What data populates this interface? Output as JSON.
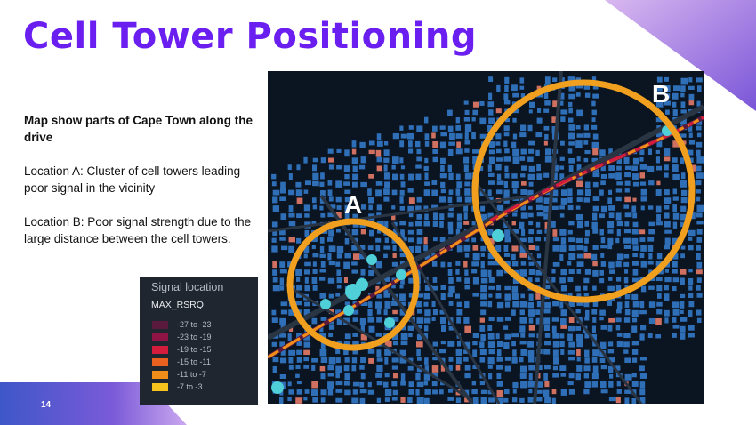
{
  "slide": {
    "title": "Cell Tower Positioning",
    "page_number": "14",
    "body": {
      "heading": "Map show parts of Cape Town along the drive",
      "location_a": "Location A: Cluster of cell towers leading poor signal in the vicinity",
      "location_b": "Location B: Poor signal strength due to the large distance between the cell towers."
    }
  },
  "map": {
    "label_a": "A",
    "label_b": "B",
    "colors": {
      "background": "#0b1522",
      "building": "#2f6fb8",
      "tower": "#4fd0d8",
      "circle": "#f0a01e",
      "road": "#2a3543"
    }
  },
  "legend": {
    "title": "Signal location",
    "field": "MAX_RSRQ",
    "items": [
      {
        "label": "-27 to -23",
        "color": "#5a1a3e"
      },
      {
        "label": "-23 to -19",
        "color": "#8e1446"
      },
      {
        "label": "-19 to -15",
        "color": "#d41c3c"
      },
      {
        "label": "-15 to -11",
        "color": "#e9601f"
      },
      {
        "label": "-11 to -7",
        "color": "#f18d19"
      },
      {
        "label": "-7 to -3",
        "color": "#f8c21c"
      }
    ]
  },
  "theme": {
    "accent": "#6a1ff0"
  }
}
